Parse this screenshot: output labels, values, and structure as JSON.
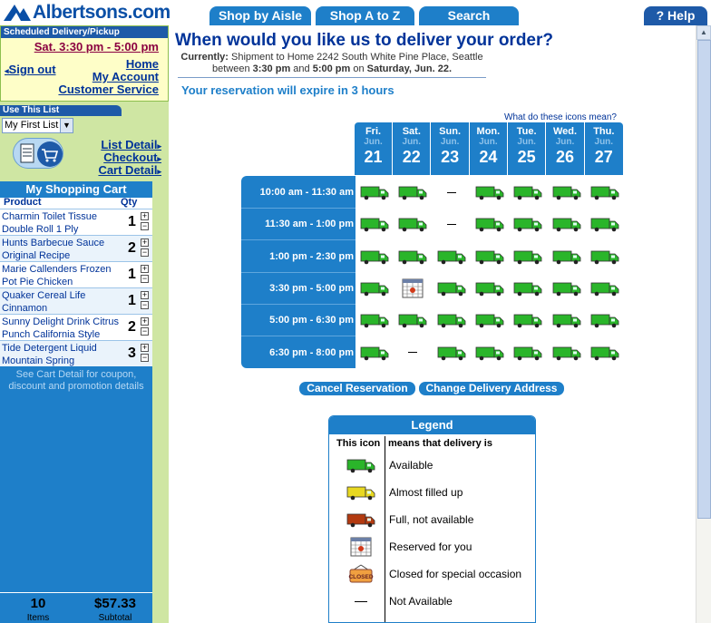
{
  "header": {
    "logo_text": "Albertsons.com",
    "tabs": [
      "Shop by Aisle",
      "Shop A to Z",
      "Search"
    ],
    "help": "? Help"
  },
  "sidebar": {
    "scheduled_label": "Scheduled Delivery/Pickup",
    "scheduled_time": "Sat. 3:30 pm - 5:00 pm",
    "sign_out": "Sign out",
    "home": "Home",
    "my_account": "My Account",
    "customer_service": "Customer Service",
    "use_list_label": "Use This List",
    "list_selected": "My First List",
    "list_detail": "List Detail",
    "checkout": "Checkout",
    "cart_detail": "Cart Detail"
  },
  "cart": {
    "title": "My Shopping Cart",
    "col_product": "Product",
    "col_qty": "Qty",
    "items": [
      {
        "name": "Charmin Toilet Tissue Double Roll 1 Ply",
        "qty": "1"
      },
      {
        "name": "Hunts Barbecue Sauce Original Recipe",
        "qty": "2"
      },
      {
        "name": "Marie Callenders Frozen Pot Pie Chicken",
        "qty": "1"
      },
      {
        "name": "Quaker Cereal Life Cinnamon",
        "qty": "1"
      },
      {
        "name": "Sunny Delight Drink Citrus Punch California Style",
        "qty": "2"
      },
      {
        "name": "Tide Detergent Liquid Mountain Spring",
        "qty": "3"
      }
    ],
    "note": "See Cart Detail for coupon, discount and promotion details",
    "items_count": "10",
    "items_label": "Items",
    "subtotal": "$57.33",
    "subtotal_label": "Subtotal"
  },
  "main": {
    "question": "When would you like us to deliver your order?",
    "currently_label": "Currently:",
    "currently_text": "Shipment to Home 2242 South White Pine Place, Seattle",
    "between_text": "between",
    "start_time": "3:30 pm",
    "and_text": "and",
    "end_time": "5:00 pm",
    "on_text": "on",
    "date_text": "Saturday, Jun. 22.",
    "expire": "Your reservation will expire in 3 hours",
    "icons_question": "What do these icons mean?",
    "days": [
      {
        "day": "Fri.",
        "month": "Jun.",
        "date": "21"
      },
      {
        "day": "Sat.",
        "month": "Jun.",
        "date": "22"
      },
      {
        "day": "Sun.",
        "month": "Jun.",
        "date": "23"
      },
      {
        "day": "Mon.",
        "month": "Jun.",
        "date": "24"
      },
      {
        "day": "Tue.",
        "month": "Jun.",
        "date": "25"
      },
      {
        "day": "Wed.",
        "month": "Jun.",
        "date": "26"
      },
      {
        "day": "Thu.",
        "month": "Jun.",
        "date": "27"
      }
    ],
    "slots": [
      "10:00 am - 11:30 am",
      "11:30 am - 1:00 pm",
      "1:00 pm - 2:30 pm",
      "3:30 pm - 5:00 pm",
      "5:00 pm - 6:30 pm",
      "6:30 pm - 8:00 pm"
    ],
    "availability": [
      [
        "available",
        "available",
        "not-available",
        "available",
        "available",
        "available",
        "available"
      ],
      [
        "available",
        "available",
        "not-available",
        "available",
        "available",
        "available",
        "available"
      ],
      [
        "available",
        "available",
        "available",
        "available",
        "available",
        "available",
        "available"
      ],
      [
        "available",
        "reserved",
        "available",
        "available",
        "available",
        "available",
        "available"
      ],
      [
        "available",
        "available",
        "available",
        "available",
        "available",
        "available",
        "available"
      ],
      [
        "available",
        "not-available",
        "available",
        "available",
        "available",
        "available",
        "available"
      ]
    ],
    "cancel_button": "Cancel Reservation",
    "change_button": "Change Delivery Address"
  },
  "legend": {
    "title": "Legend",
    "col_icon": "This icon",
    "col_meaning": "means that delivery is",
    "rows": [
      {
        "icon": "truck-green-icon",
        "text": "Available"
      },
      {
        "icon": "truck-yellow-icon",
        "text": "Almost filled up"
      },
      {
        "icon": "truck-red-icon",
        "text": "Full, not available"
      },
      {
        "icon": "calendar-icon",
        "text": "Reserved for you"
      },
      {
        "icon": "closed-sign-icon",
        "text": "Closed for special occasion"
      },
      {
        "icon": "dash-icon",
        "text": "Not Available"
      }
    ],
    "closed_sign_text": "CLOSED"
  },
  "colors": {
    "accent": "#1e7fc9",
    "sidebar": "#cfe6a3",
    "truck_green": "#2ab52a",
    "truck_yellow": "#e8d820",
    "truck_red": "#b33a10"
  }
}
